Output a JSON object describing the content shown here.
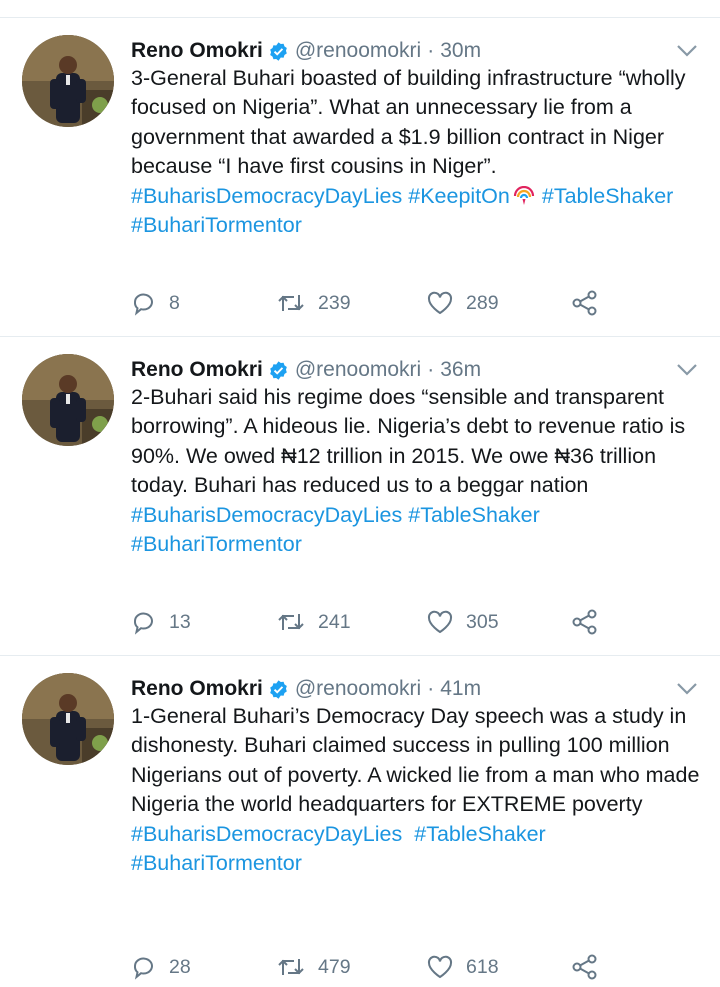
{
  "tweets": [
    {
      "author_name": "Reno Omokri",
      "handle": "@renoomokri",
      "separator": "·",
      "time": "30m",
      "text": "3-General Buhari boasted of building infrastructure “wholly focused on Nigeria”. What an unnecessary lie from a government that awarded a $1.9 billion contract in Niger because “I have first cousins in Niger”.",
      "hashtags": [
        "#BuharisDemocracyDayLies",
        "#KeepitOn",
        "#TableShaker",
        "#BuhariTormentor"
      ],
      "inline_icon": "rainbow-signal-icon",
      "replies": "8",
      "retweets": "239",
      "likes": "289"
    },
    {
      "author_name": "Reno Omokri",
      "handle": "@renoomokri",
      "separator": "·",
      "time": "36m",
      "text": "2-Buhari said his regime does “sensible and transparent borrowing”. A hideous lie. Nigeria’s debt to revenue ratio is 90%. We owed ₦12 trillion in 2015. We owe ₦36 trillion today. Buhari has reduced us to a beggar nation",
      "hashtags": [
        "#BuharisDemocracyDayLies",
        "#TableShaker",
        "#BuhariTormentor"
      ],
      "replies": "13",
      "retweets": "241",
      "likes": "305"
    },
    {
      "author_name": "Reno Omokri",
      "handle": "@renoomokri",
      "separator": "·",
      "time": "41m",
      "text": "1-General Buhari’s Democracy Day speech was a study in dishonesty. Buhari claimed success in pulling 100 million Nigerians out of poverty. A wicked lie from a man who made Nigeria the world headquarters for EXTREME poverty",
      "hashtags": [
        "#BuharisDemocracyDayLies",
        "#TableShaker",
        "#BuhariTormentor"
      ],
      "replies": "28",
      "retweets": "479",
      "likes": "618"
    }
  ],
  "colors": {
    "link": "#1b95e0",
    "secondary": "#657786",
    "text": "#14171a",
    "verified": "#1da1f2",
    "divider": "#e6ecf0"
  },
  "icons": {
    "verified": "verified-badge-icon",
    "caret": "chevron-down-icon",
    "reply": "reply-icon",
    "retweet": "retweet-icon",
    "like": "heart-icon",
    "share": "share-icon"
  }
}
